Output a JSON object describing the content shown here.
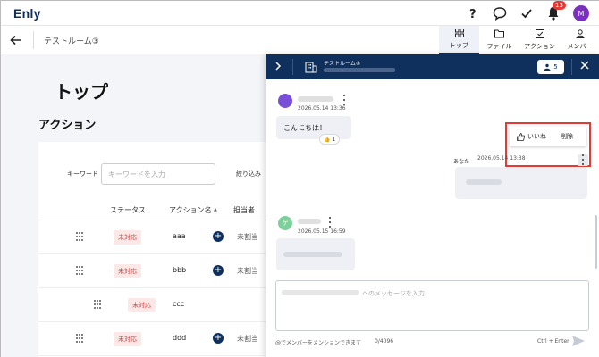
{
  "app": {
    "logo": "Enly"
  },
  "header": {
    "notification_count": "13",
    "avatar_initial": "M"
  },
  "room": {
    "name": "テストルーム③"
  },
  "tabs": [
    {
      "label": "トップ"
    },
    {
      "label": "ファイル"
    },
    {
      "label": "アクション"
    },
    {
      "label": "メンバー"
    }
  ],
  "page": {
    "title": "トップ",
    "section": "アクション"
  },
  "filters": {
    "keyword_label": "キーワード",
    "keyword_placeholder": "キーワードを入力",
    "filter_label": "絞り込み"
  },
  "table": {
    "headers": {
      "status": "ステータス",
      "action": "アクション名",
      "assignee": "担当者"
    },
    "sort_mark": "▲",
    "rows": [
      {
        "status": "未対応",
        "action": "aaa",
        "assignee": "未割当"
      },
      {
        "status": "未対応",
        "action": "bbb",
        "assignee": "未割当"
      },
      {
        "status": "未対応",
        "action": "ccc",
        "assignee": ""
      },
      {
        "status": "未対応",
        "action": "ddd",
        "assignee": "未割当"
      }
    ]
  },
  "chat": {
    "title": "テストルーム④",
    "member_count": "5",
    "messages": [
      {
        "time": "2026.05.14 13:36",
        "text": "こんにちは！",
        "reaction_count": "1"
      },
      {
        "sender": "あなた",
        "time": "2026.05.14 13:38"
      },
      {
        "avatar_initial": "ゲ",
        "time": "2026.05.15 16:59"
      }
    ],
    "popup": {
      "like_label": "いいね",
      "delete_label": "削除"
    },
    "input_placeholder_suffix": "へのメッセージを入力",
    "mention_hint": "@でメンバーをメンションできます",
    "char_count": "0/4096",
    "send_shortcut": "Ctrl + Enter"
  },
  "colors": {
    "navy": "#0f2f5c",
    "status_red": "#d64541",
    "highlight": "#e53935",
    "avatar_purple": "#7b2fbe"
  }
}
